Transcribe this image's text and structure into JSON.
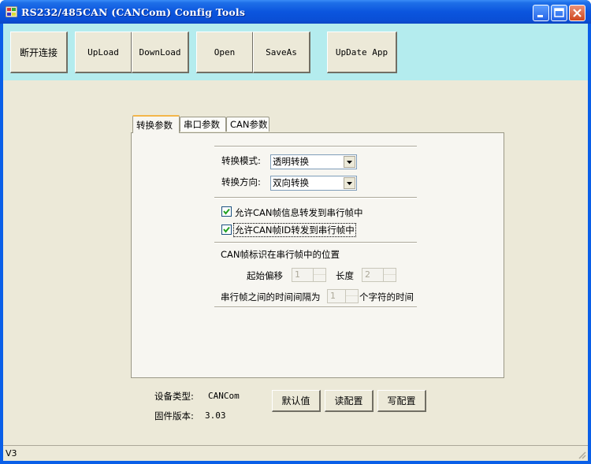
{
  "window": {
    "title": "RS232/485CAN (CANCom)  Config Tools"
  },
  "toolbar": {
    "disconnect_label": "断开连接",
    "upload_label": "UpLoad",
    "download_label": "DownLoad",
    "open_label": "Open",
    "saveas_label": "SaveAs",
    "update_label": "UpDate App"
  },
  "tabs": [
    {
      "label": "转换参数",
      "active": true
    },
    {
      "label": "串口参数",
      "active": false
    },
    {
      "label": "CAN参数",
      "active": false
    }
  ],
  "convert": {
    "mode_label": "转换模式:",
    "mode_value": "透明转换",
    "direction_label": "转换方向:",
    "direction_value": "双向转换",
    "allow_can_info_label": "允许CAN帧信息转发到串行帧中",
    "allow_can_info_checked": true,
    "allow_can_id_label": "允许CAN帧ID转发到串行帧中",
    "allow_can_id_checked": true,
    "position_title": "CAN帧标识在串行帧中的位置",
    "offset_label": "起始偏移",
    "offset_value": "1",
    "length_label": "长度",
    "length_value": "2",
    "interval_label": "串行帧之间的时间间隔为",
    "interval_value": "1",
    "interval_suffix": "个字符的时间"
  },
  "device": {
    "type_label": "设备类型:",
    "type_value": "CANCom",
    "firmware_label": "固件版本:",
    "firmware_value": "3.03"
  },
  "actions": {
    "default_label": "默认值",
    "read_label": "读配置",
    "write_label": "写配置"
  },
  "status": {
    "text": "V3"
  }
}
